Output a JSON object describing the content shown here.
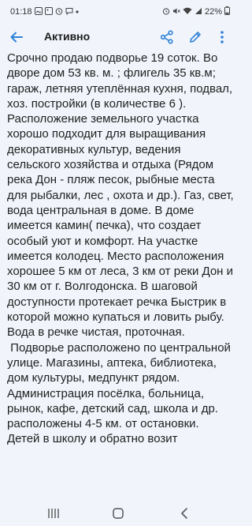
{
  "status_bar": {
    "time": "01:18",
    "battery": "22%",
    "icons_left": [
      "gallery-icon",
      "image-icon",
      "alarm-icon",
      "chat-icon",
      "dot-icon"
    ],
    "icons_right": [
      "alarm-clock-icon",
      "mute-icon",
      "wifi-icon",
      "signal-icon",
      "battery-icon"
    ]
  },
  "app_bar": {
    "title": "Активно",
    "back_icon": "arrow-left-icon",
    "actions": [
      "share-icon",
      "edit-pencil-icon",
      "more-vert-icon"
    ],
    "accent": "#2f80d6"
  },
  "note": {
    "text": "Срочно продаю подворье 19 соток. Во дворе дом 53 кв. м. ; флигель 35 кв.м; гараж, летняя утеплённая кухня, подвал, хоз. постройки (в количестве 6 ). Расположение земельного участка хорошо подходит для выращивания декоративных культур, ведения сельского хозяйства и отдыха (Рядом река Дон - пляж песок, рыбные места для рыбалки, лес , охота и др.). Газ, свет, вода центральная в доме. В доме имеется камин( печка), что создает особый уют и комфорт. На участке имеется колодец. Место расположения хорошее 5 км от леса, 3 км от реки Дон и 30 км от г. Волгодонска. В шаговой доступности протекает речка Быстрик в которой можно купаться и ловить рыбу. Вода в речке чистая, проточная.\n Подворье расположено по центральной улице. Магазины, аптека, библиотека, дом культуры, медпункт рядом. Администрация посёлка, больница, рынок, кафе, детский сад, школа и др. расположены 4-5 км. от остановки. Детей в школу и обратно возит"
  },
  "nav_bar": {
    "items": [
      "recents-icon",
      "home-icon",
      "back-icon"
    ]
  }
}
